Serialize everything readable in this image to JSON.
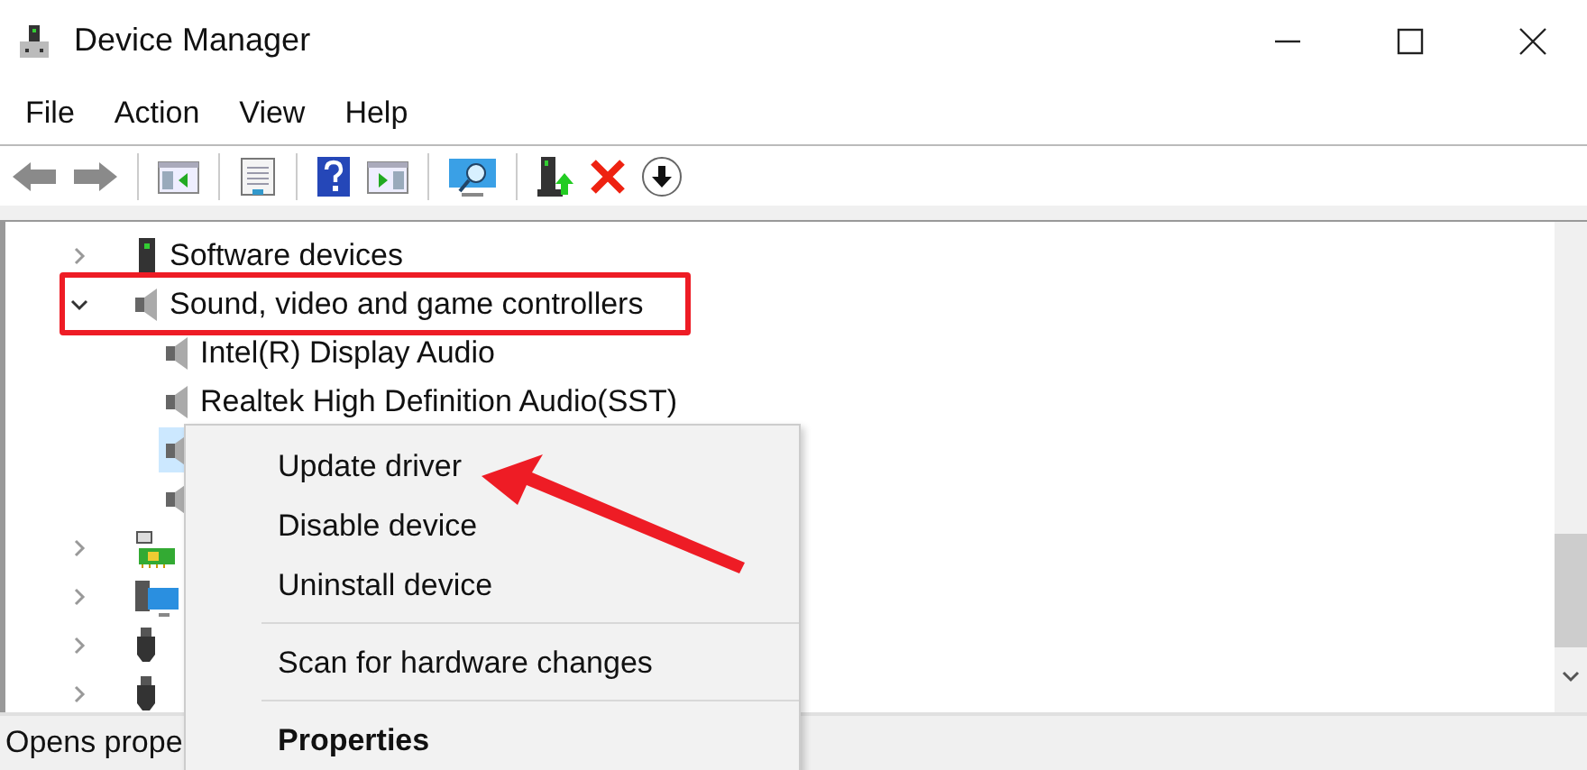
{
  "window": {
    "title": "Device Manager"
  },
  "menu_bar": [
    "File",
    "Action",
    "View",
    "Help"
  ],
  "toolbar": [
    {
      "kind": "back"
    },
    {
      "kind": "forward"
    },
    {
      "kind": "separator"
    },
    {
      "kind": "console-tree"
    },
    {
      "kind": "separator"
    },
    {
      "kind": "properties"
    },
    {
      "kind": "separator"
    },
    {
      "kind": "help"
    },
    {
      "kind": "action-pane"
    },
    {
      "kind": "separator"
    },
    {
      "kind": "scan"
    },
    {
      "kind": "separator"
    },
    {
      "kind": "update"
    },
    {
      "kind": "uninstall"
    },
    {
      "kind": "download"
    }
  ],
  "tree": [
    {
      "label": "Software devices",
      "kind": "chip",
      "expanded": false,
      "selected": false
    },
    {
      "label": "Sound, video and game controllers",
      "kind": "speaker",
      "expanded": true,
      "selected": false,
      "children": [
        {
          "label": "Intel(R) Display Audio",
          "kind": "speaker",
          "selected": false
        },
        {
          "label": "Realtek High Definition Audio(SST)",
          "kind": "speaker",
          "selected": false
        },
        {
          "kind": "speaker",
          "selected": true
        },
        {
          "kind": "speaker",
          "selected": false
        }
      ]
    },
    {
      "kind": "board",
      "expanded": false,
      "selected": false
    },
    {
      "kind": "computer",
      "expanded": false,
      "selected": false
    },
    {
      "kind": "usb",
      "expanded": false,
      "selected": false
    },
    {
      "kind": "usb",
      "expanded": false,
      "selected": false
    }
  ],
  "status_bar": {
    "text": "Opens prope"
  },
  "context_menu": {
    "items": [
      {
        "kind": "item",
        "label": "Update driver",
        "default": false
      },
      {
        "kind": "item",
        "label": "Disable device",
        "default": false
      },
      {
        "kind": "item",
        "label": "Uninstall device",
        "default": false
      },
      {
        "kind": "separator"
      },
      {
        "kind": "item",
        "label": "Scan for hardware changes",
        "default": false
      },
      {
        "kind": "separator"
      },
      {
        "kind": "item",
        "label": "Properties",
        "default": true
      }
    ]
  },
  "annotations": {
    "highlight_box": true,
    "arrow": true
  }
}
